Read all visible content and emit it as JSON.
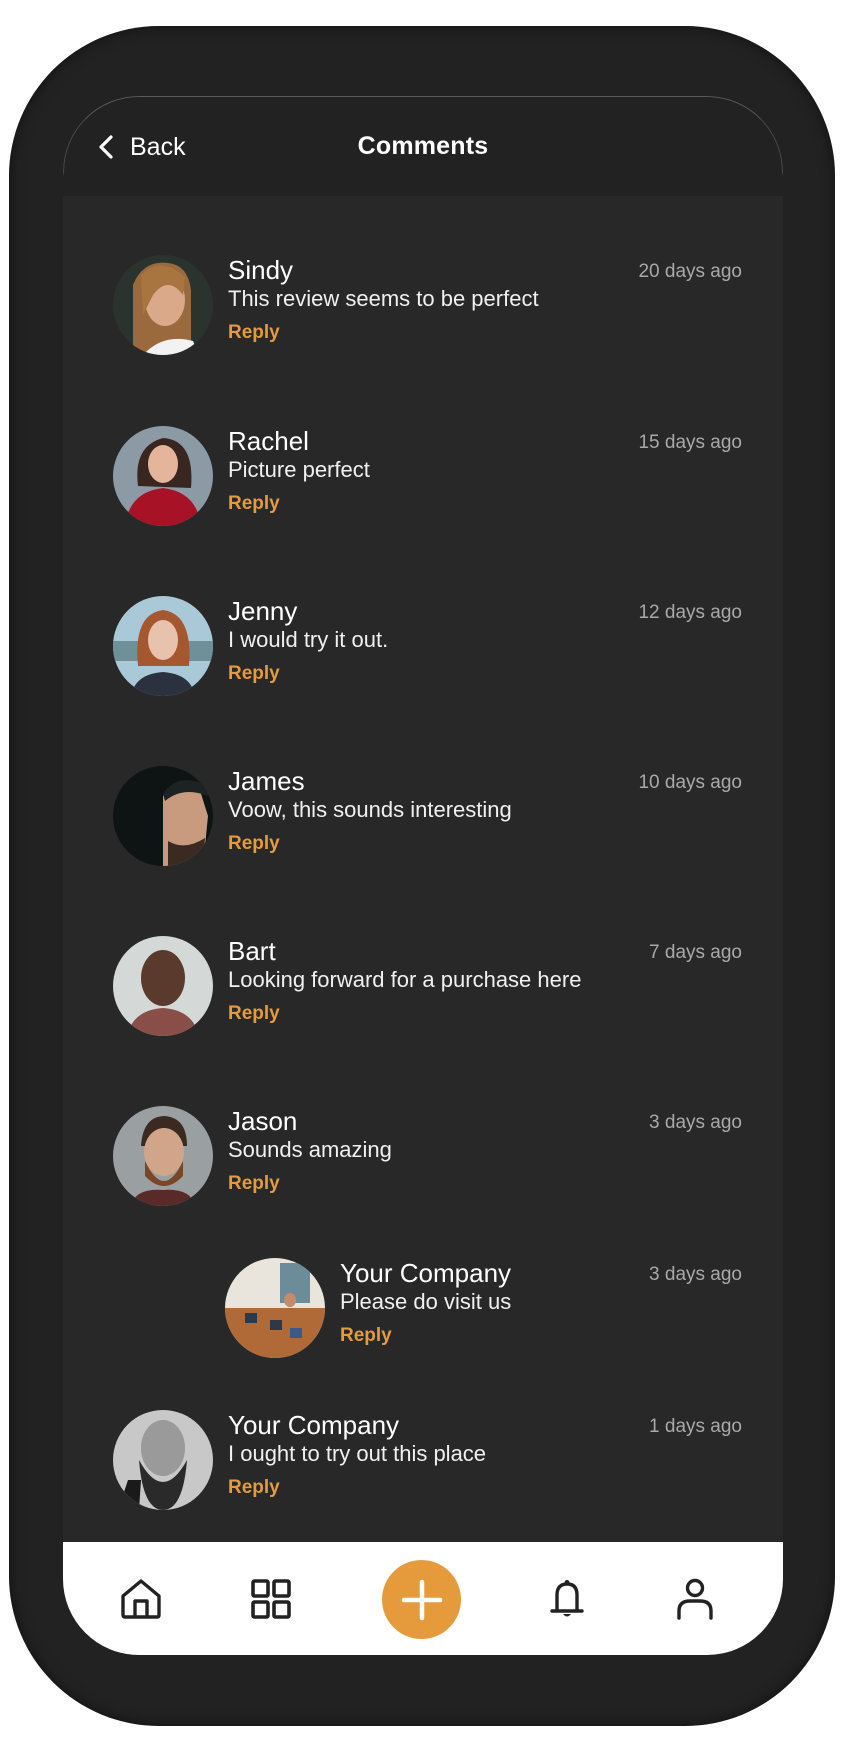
{
  "header": {
    "back_label": "Back",
    "back_icon": "chevron-left-icon",
    "title": "Comments"
  },
  "colors": {
    "accent": "#E59A3C",
    "frame": "#222222",
    "content_bg": "#282828",
    "timestamp": "#a9a9a9",
    "navbar_bg": "#ffffff"
  },
  "comments": [
    {
      "name": "Sindy",
      "text": "This review seems to be perfect",
      "time": "20 days ago",
      "reply_label": "Reply",
      "avatar": "woman-long-hair-photo",
      "nested": false
    },
    {
      "name": "Rachel",
      "text": "Picture perfect",
      "time": "15 days ago",
      "reply_label": "Reply",
      "avatar": "woman-red-sweater-photo",
      "nested": false
    },
    {
      "name": "Jenny",
      "text": "I would try it out.",
      "time": "12 days ago",
      "reply_label": "Reply",
      "avatar": "woman-red-hair-photo",
      "nested": false
    },
    {
      "name": "James",
      "text": "Voow, this sounds interesting",
      "time": "10 days ago",
      "reply_label": "Reply",
      "avatar": "man-half-shadow-photo",
      "nested": false
    },
    {
      "name": "Bart",
      "text": "Looking forward for a purchase here",
      "time": "7 days ago",
      "reply_label": "Reply",
      "avatar": "man-portrait-photo",
      "nested": false
    },
    {
      "name": "Jason",
      "text": "Sounds amazing",
      "time": "3 days ago",
      "reply_label": "Reply",
      "avatar": "bearded-man-photo",
      "nested": false
    },
    {
      "name": "Your Company",
      "text": "Please do visit us",
      "time": "3 days ago",
      "reply_label": "Reply",
      "avatar": "office-workspace-photo",
      "nested": true
    },
    {
      "name": "Your Company",
      "text": "I ought to try out this place",
      "time": "1 days ago",
      "reply_label": "Reply",
      "avatar": "bald-bearded-man-photo",
      "nested": false
    }
  ],
  "navbar": {
    "items": [
      {
        "name": "home",
        "icon": "home-icon"
      },
      {
        "name": "categories",
        "icon": "grid-icon"
      },
      {
        "name": "add",
        "icon": "plus-icon"
      },
      {
        "name": "notifications",
        "icon": "bell-icon"
      },
      {
        "name": "profile",
        "icon": "person-icon"
      }
    ]
  }
}
